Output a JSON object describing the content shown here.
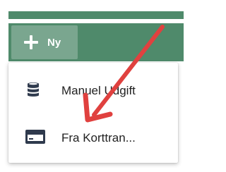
{
  "toolbar": {
    "new_button": {
      "icon": "plus-icon",
      "label": "Ny"
    }
  },
  "menu": {
    "items": [
      {
        "icon": "database-icon",
        "label": "Manuel Udgift"
      },
      {
        "icon": "credit-card-icon",
        "label": "Fra Korttran..."
      }
    ]
  },
  "annotation": {
    "arrow_color": "#e0413f"
  },
  "colors": {
    "toolbar_green": "#4f8a6b",
    "button_green": "#7aa68f",
    "icon_dark": "#2f3a4d"
  }
}
